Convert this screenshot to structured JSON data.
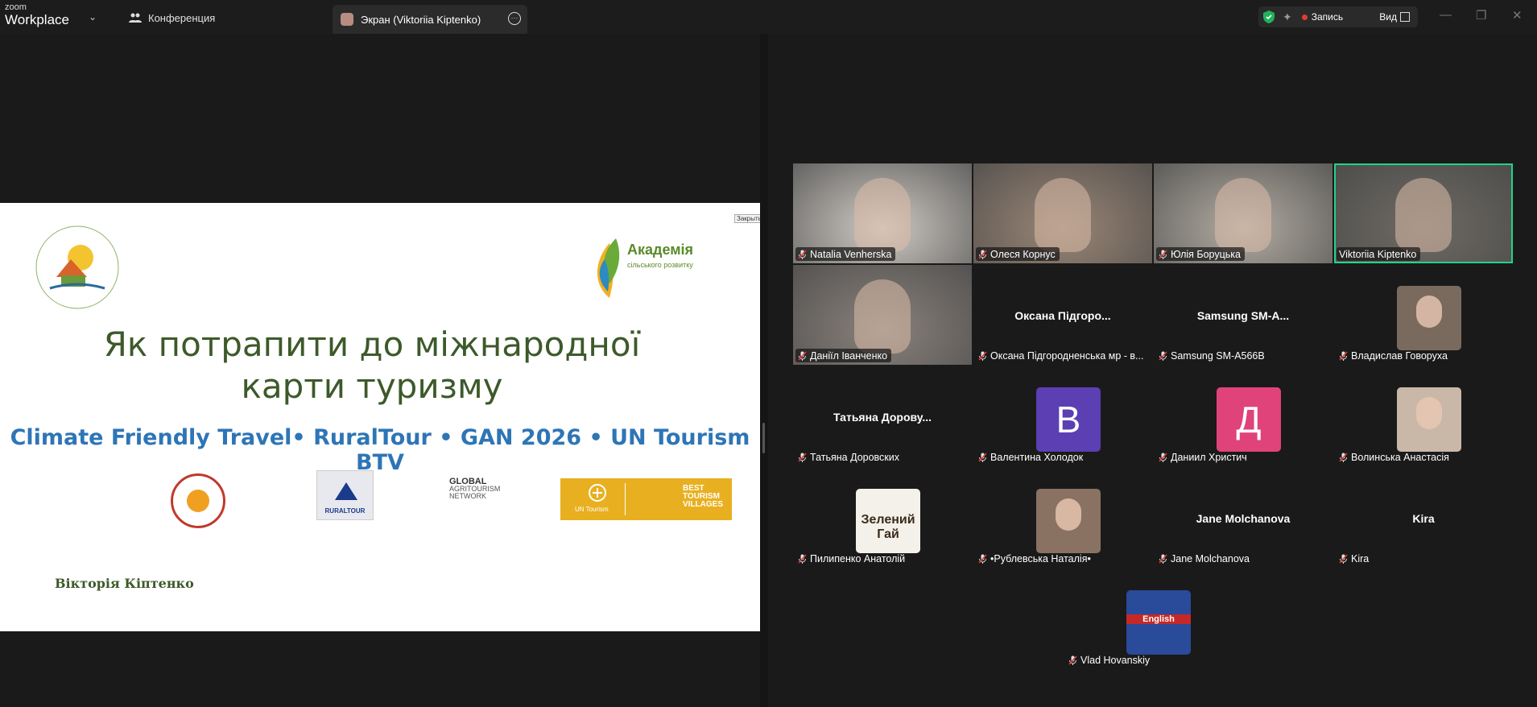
{
  "app": {
    "logo_top": "zoom",
    "logo_bottom": "Workplace"
  },
  "tabs": {
    "conference_label": "Конференция",
    "screen_label": "Экран (Viktoriia Kiptenko)"
  },
  "toolbar": {
    "record_label": "Запись",
    "view_label": "Вид"
  },
  "slide": {
    "close_label": "Закрыть",
    "academy_name": "Академія",
    "academy_sub": "сільського розвитку",
    "title_line1": "Як потрапити до міжнародної",
    "title_line2": "карти туризму",
    "subtitle": "Climate Friendly Travel• RuralTour • GAN 2026 • UN Tourism BTV",
    "rural_logo_text": "RURALTOUR",
    "gan_line1": "GLOBAL",
    "gan_line2": "AGRITOURISM",
    "gan_line3": "NETWORK",
    "untourism_text": "UN Tourism",
    "btv_line1": "BEST",
    "btv_line2": "TOURISM",
    "btv_line3": "VILLAGES",
    "author": "Вікторія Кіптенко"
  },
  "participants": [
    {
      "name": "Natalia Venherska",
      "type": "video",
      "muted": true,
      "bg": "#cfcac4"
    },
    {
      "name": "Олеся Корнус",
      "type": "video",
      "muted": true,
      "bg": "#9a8676"
    },
    {
      "name": "Юлія Боруцька",
      "type": "video",
      "muted": true,
      "bg": "#b2aca2"
    },
    {
      "name": "Viktoriia Kiptenko",
      "type": "video",
      "muted": false,
      "active": true,
      "bg": "#6e6a64"
    },
    {
      "name": "Даніїл Іванченко",
      "type": "video",
      "muted": true,
      "bg": "#8a827c"
    },
    {
      "name": "Оксана Підгородненська мр - в...",
      "display": "Оксана  Підгоро...",
      "type": "name",
      "muted": true
    },
    {
      "name": "Samsung SM-A566B",
      "display": "Samsung  SM-A...",
      "type": "name",
      "muted": true
    },
    {
      "name": "Владислав Говоруха",
      "type": "avatar",
      "muted": true,
      "bg": "#7a6a5e"
    },
    {
      "name": "Татьяна Доровских",
      "display": "Татьяна  Дорову...",
      "type": "name",
      "muted": true
    },
    {
      "name": "Валентина Холодок",
      "type": "letter",
      "letter": "В",
      "bg": "#5b3fb3",
      "muted": true
    },
    {
      "name": "Даниил Христич",
      "type": "letter",
      "letter": "Д",
      "bg": "#e0437a",
      "muted": true
    },
    {
      "name": "Волинська Анастасія",
      "type": "avatar",
      "muted": true,
      "bg": "#c9b8a8"
    },
    {
      "name": "Пилипенко Анатолій",
      "type": "avatar",
      "muted": true,
      "bg": "#f4f1ea",
      "avatar_text": "Зелений Гай"
    },
    {
      "name": "•Рублевська Наталія•",
      "type": "avatar",
      "muted": true,
      "bg": "#8a7262"
    },
    {
      "name": "Jane Molchanova",
      "display": "Jane Molchanova",
      "type": "name",
      "muted": true
    },
    {
      "name": "Kira",
      "display": "Kira",
      "type": "name",
      "muted": true
    },
    {
      "name": "Vlad Hovanskiy",
      "type": "avatar",
      "muted": true,
      "bg": "#2a4a9a",
      "avatar_text": "English"
    }
  ]
}
